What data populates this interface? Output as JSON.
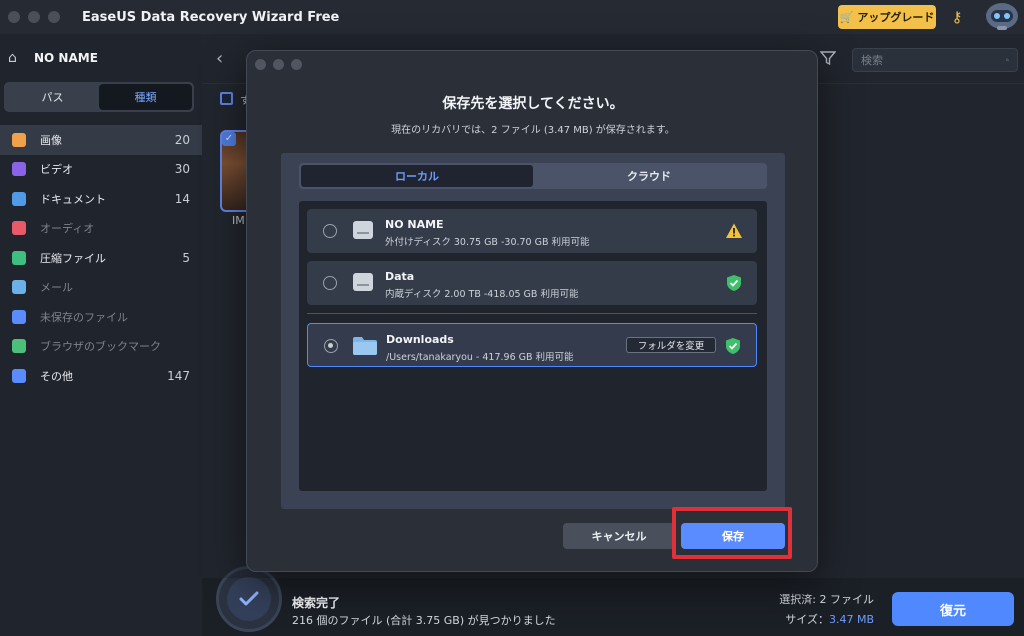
{
  "window": {
    "title": "EaseUS Data Recovery Wizard  Free"
  },
  "header": {
    "upgrade_label": "アップグレード"
  },
  "sidebar": {
    "drive_name": "NO NAME",
    "view_tabs": [
      "パス",
      "種類"
    ],
    "categories": [
      {
        "label": "画像",
        "count": "20",
        "color": "#f0a14a"
      },
      {
        "label": "ビデオ",
        "count": "30",
        "color": "#8a63e8"
      },
      {
        "label": "ドキュメント",
        "count": "14",
        "color": "#4f9be8"
      },
      {
        "label": "オーディオ",
        "count": "",
        "color": "#e85a6a"
      },
      {
        "label": "圧縮ファイル",
        "count": "5",
        "color": "#3fbf7f"
      },
      {
        "label": "メール",
        "count": "",
        "color": "#6cb0e8"
      },
      {
        "label": "未保存のファイル",
        "count": "",
        "color": "#5b8cff"
      },
      {
        "label": "ブラウザのブックマーク",
        "count": "",
        "color": "#4cc07a"
      },
      {
        "label": "その他",
        "count": "147",
        "color": "#5b8cff"
      }
    ]
  },
  "main": {
    "search_placeholder": "検索",
    "select_all_label": "す",
    "thumb_label": "IM"
  },
  "modal": {
    "title": "保存先を選択してください。",
    "subtitle": "現在のリカバリでは、2 ファイル (3.47 MB) が保存されます。",
    "tabs": [
      "ローカル",
      "クラウド"
    ],
    "locations": [
      {
        "name": "NO NAME",
        "info": "外付けディスク 30.75 GB -30.70 GB 利用可能",
        "status": "warning"
      },
      {
        "name": "Data",
        "info": "内蔵ディスク 2.00 TB -418.05 GB 利用可能",
        "status": "ok"
      },
      {
        "name": "Downloads",
        "info": "/Users/tanakaryou - 417.96 GB 利用可能",
        "status": "ok"
      }
    ],
    "change_folder_label": "フォルダを変更",
    "cancel_label": "キャンセル",
    "save_label": "保存"
  },
  "footer": {
    "done_title": "検索完了",
    "found_summary": "216 個のファイル (合計 3.75 GB) が見つかりました",
    "selected_label": "選択済: 2 ファイル",
    "size_label": "サイズ：",
    "size_value": "3.47 MB",
    "recover_label": "復元"
  }
}
